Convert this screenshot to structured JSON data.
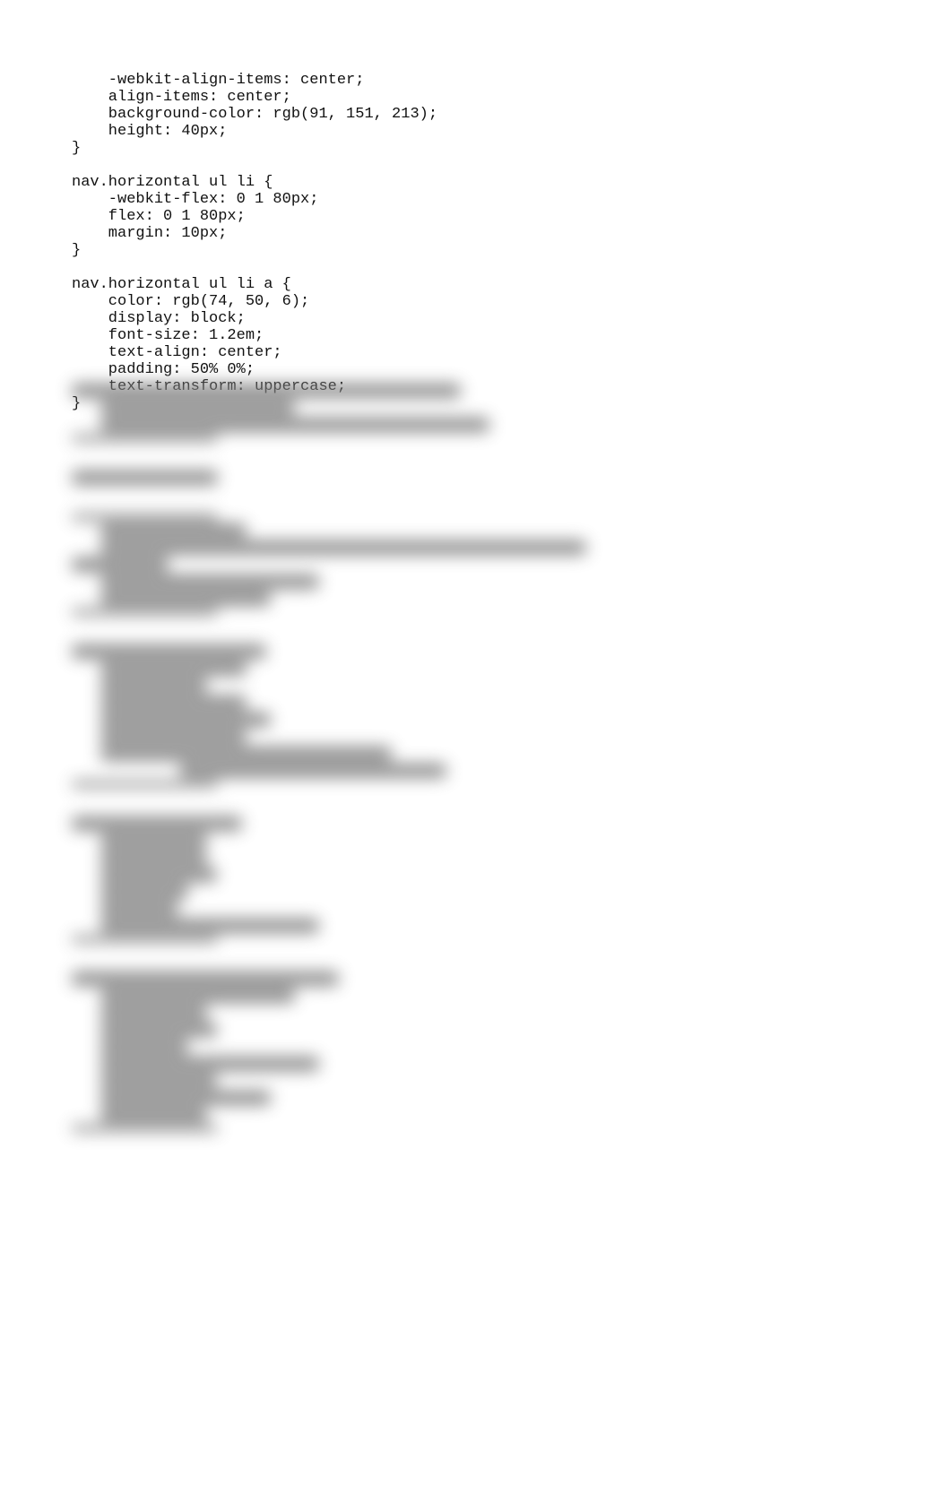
{
  "code_lines": [
    "    -webkit-align-items: center;",
    "    align-items: center;",
    "    background-color: rgb(91, 151, 213);",
    "    height: 40px;",
    "}",
    "",
    "nav.horizontal ul li {",
    "    -webkit-flex: 0 1 80px;",
    "    flex: 0 1 80px;",
    "    margin: 10px;",
    "}",
    "",
    "nav.horizontal ul li a {",
    "    color: rgb(74, 50, 6);",
    "    display: block;",
    "    font-size: 1.2em;",
    "    text-align: center;",
    "    padding: 50% 0%;",
    "    text-transform: uppercase;",
    "}"
  ],
  "obscured_region": {
    "note": "The lower half of the page is blurred/obscured in the screenshot and its text is not legible.",
    "blocks": [
      {
        "lines": 4
      },
      {
        "lines": 1
      },
      {
        "lines": 6
      },
      {
        "lines": 9
      },
      {
        "lines": 7
      },
      {
        "lines": 9
      }
    ]
  }
}
